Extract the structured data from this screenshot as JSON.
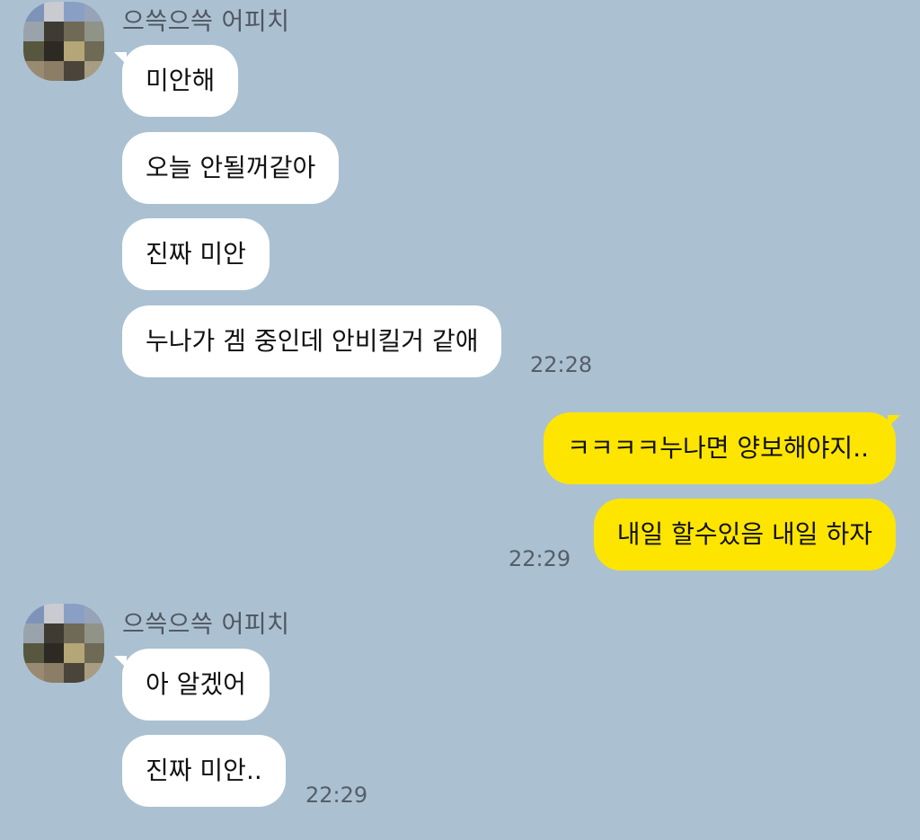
{
  "colors": {
    "background": "#abc1d1",
    "incoming_bubble": "#ffffff",
    "outgoing_bubble": "#fee500"
  },
  "groups": [
    {
      "sender": "으쓱으쓱 어피치",
      "direction": "incoming",
      "messages": [
        "미안해",
        "오늘 안될꺼같아",
        "진짜 미안",
        "누나가 겜 중인데 안비킬거 같애"
      ],
      "time": "22:28"
    },
    {
      "sender": "",
      "direction": "outgoing",
      "messages": [
        "ㅋㅋㅋㅋ누나면 양보해야지..",
        "내일 할수있음 내일 하자"
      ],
      "time": "22:29"
    },
    {
      "sender": "으쓱으쓱 어피치",
      "direction": "incoming",
      "messages": [
        "아 알겠어",
        "진짜 미안.."
      ],
      "time": "22:29"
    }
  ]
}
